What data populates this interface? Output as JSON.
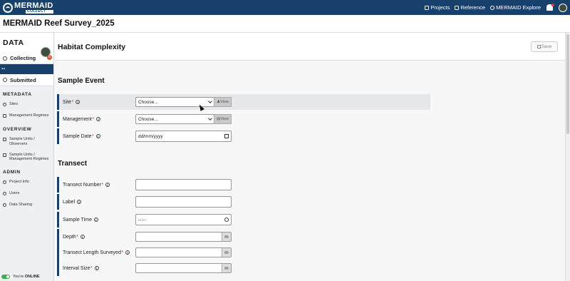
{
  "app": {
    "logo_main": "MERMAID",
    "logo_sub": "COLLECT",
    "nav": [
      {
        "label": "Projects",
        "icon": "projects-icon"
      },
      {
        "label": "Reference",
        "icon": "reference-icon"
      },
      {
        "label": "MERMAID Explore",
        "icon": "explore-icon"
      }
    ],
    "project_title": "MERMAID Reef Survey_2025"
  },
  "sidebar": {
    "heading": "DATA",
    "collecting_label": "Collecting",
    "collecting_badge": "6",
    "collapse_symbol": "↤",
    "submitted_label": "Submitted",
    "sections": [
      {
        "title": "METADATA",
        "items": [
          {
            "label": "Sites"
          },
          {
            "label": "Management Regimes"
          }
        ]
      },
      {
        "title": "OVERVIEW",
        "items": [
          {
            "label": "Sample Units / Observers"
          },
          {
            "label": "Sample Units / Management Regimes"
          }
        ]
      },
      {
        "title": "ADMIN",
        "items": [
          {
            "label": "Project Info"
          },
          {
            "label": "Users"
          },
          {
            "label": "Data Sharing"
          }
        ]
      }
    ],
    "online_prefix": "You're",
    "online_status": "ONLINE"
  },
  "page": {
    "title": "Habitat Complexity",
    "save_label": "Save"
  },
  "sample_event": {
    "title": "Sample Event",
    "site": {
      "label": "Site",
      "required": "*",
      "value": "Choose...",
      "view_label": "View"
    },
    "management": {
      "label": "Management",
      "required": "*",
      "value": "Choose...",
      "view_label": "View"
    },
    "sample_date": {
      "label": "Sample Date",
      "required": "*",
      "placeholder": "dd/mm/yyyy"
    }
  },
  "transect": {
    "title": "Transect",
    "transect_number": {
      "label": "Transect Number",
      "required": "*",
      "value": ""
    },
    "label": {
      "label": "Label",
      "value": ""
    },
    "sample_time": {
      "label": "Sample Time",
      "placeholder": "--:--"
    },
    "depth": {
      "label": "Depth",
      "required": "*",
      "value": "",
      "unit": "m"
    },
    "transect_length": {
      "label": "Transect Length Surveyed",
      "required": "*",
      "value": "",
      "unit": "m"
    },
    "interval_size": {
      "label": "Interval Size",
      "required": "*",
      "value": "",
      "unit": "m"
    }
  },
  "colors": {
    "brand_navy": "#17406d",
    "required_red": "#c0392b",
    "online_green": "#3cae4e",
    "badge_orange": "#e2552f"
  }
}
